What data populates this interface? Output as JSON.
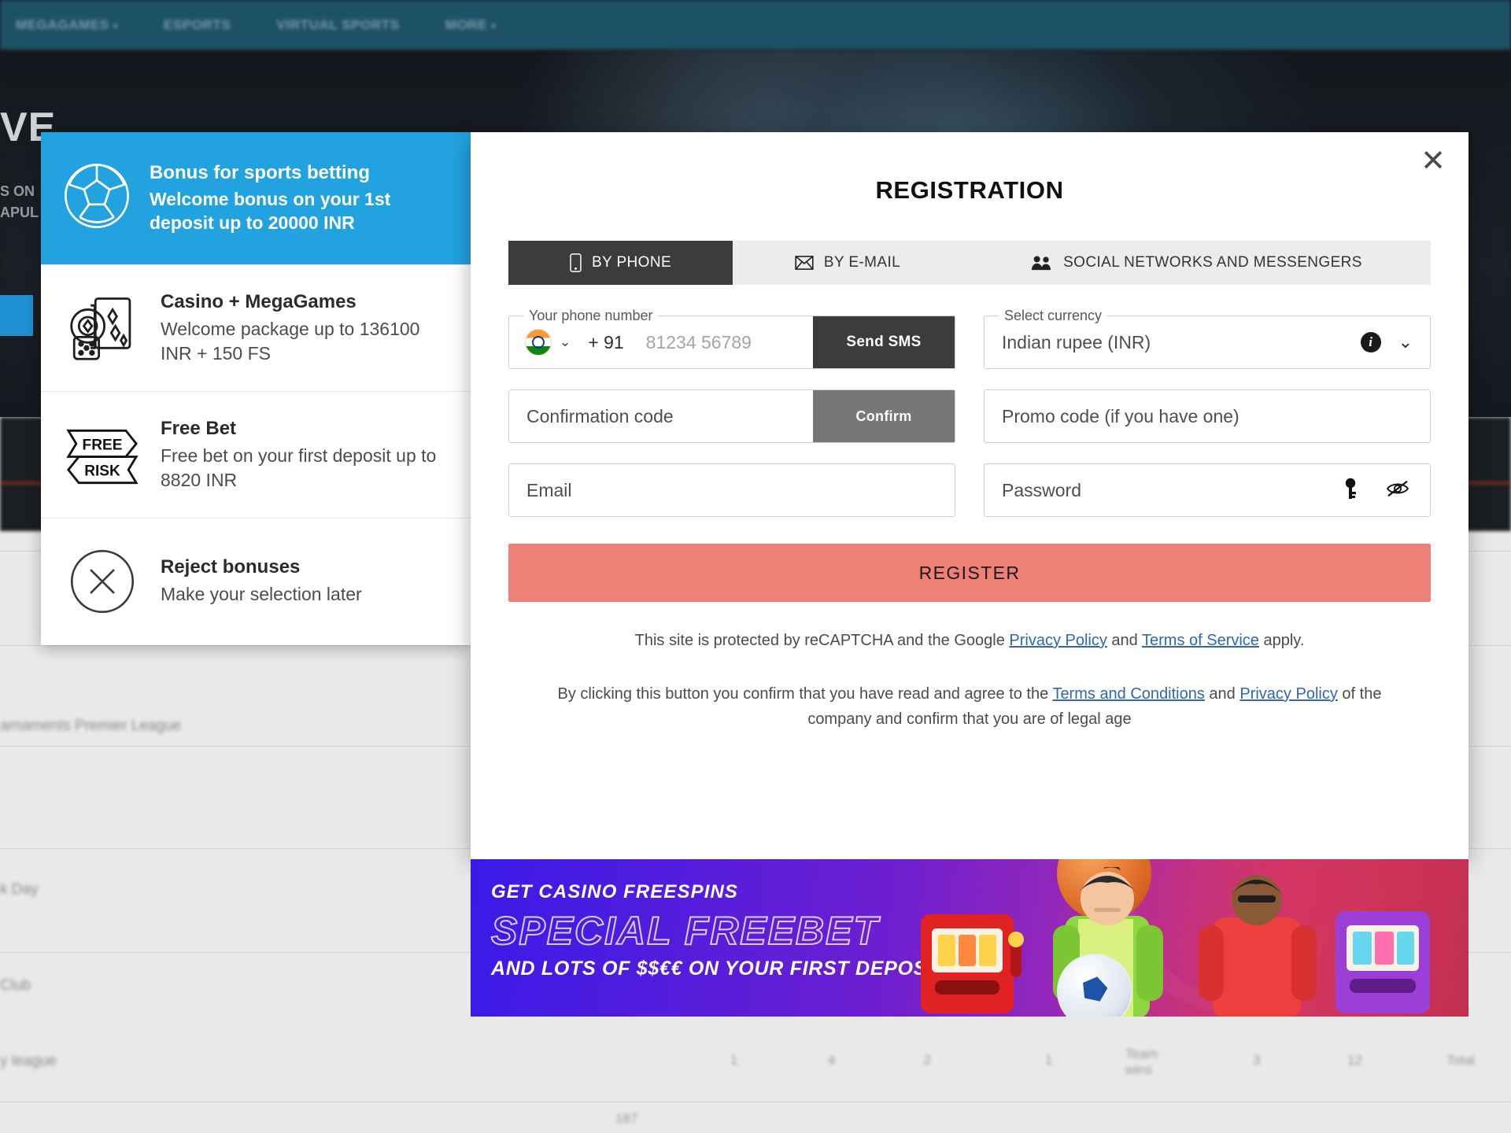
{
  "background": {
    "nav_items": [
      {
        "label": "MEGAGAMES",
        "has_caret": true
      },
      {
        "label": "ESPORTS",
        "has_caret": false
      },
      {
        "label": "VIRTUAL SPORTS",
        "has_caret": false
      },
      {
        "label": "MORE",
        "has_caret": true
      }
    ],
    "hero_title": "VE",
    "hero_sub_line1": "S ON",
    "hero_sub_line2": "APUL",
    "rows": [
      "arnaments Premier League",
      "k Day",
      " Club",
      "y league"
    ],
    "col_numbers": [
      "1",
      "4",
      "2",
      "1",
      "Team\nwins",
      "3",
      "12",
      "Total"
    ],
    "footer_number": "187"
  },
  "bonus_panel": {
    "header": {
      "icon": "soccer-ball-icon",
      "title": "Bonus for sports betting",
      "subtitle": "Welcome bonus on your 1st deposit up to 20000 INR",
      "accent_color": "#22a2df"
    },
    "options": [
      {
        "icon": "casino-chips-cards-icon",
        "title": "Casino + MegaGames",
        "subtitle": "Welcome package up to 136100 INR + 150 FS"
      },
      {
        "icon": "free-risk-bet-icon",
        "title": "Free Bet",
        "subtitle": "Free bet on your first deposit up to 8820 INR"
      },
      {
        "icon": "circle-x-icon",
        "title": "Reject bonuses",
        "subtitle": "Make your selection later"
      }
    ]
  },
  "registration": {
    "title": "REGISTRATION",
    "close_label": "✕",
    "tabs": [
      {
        "id": "phone",
        "label": "BY PHONE",
        "icon": "mobile-phone-icon",
        "active": true
      },
      {
        "id": "email",
        "label": "BY E-MAIL",
        "icon": "envelope-icon",
        "active": false
      },
      {
        "id": "social",
        "label": "SOCIAL NETWORKS AND MESSENGERS",
        "icon": "people-group-icon",
        "active": false
      }
    ],
    "fields": {
      "phone": {
        "legend": "Your phone number",
        "country_flag": "india-flag-icon",
        "dial_code": "+ 91",
        "placeholder": "81234 56789",
        "button_label": "Send SMS"
      },
      "currency": {
        "legend": "Select currency",
        "value": "Indian rupee (INR)",
        "info_icon": "info-icon",
        "chevron_icon": "chevron-down-icon"
      },
      "confirmation": {
        "placeholder": "Confirmation code",
        "button_label": "Confirm"
      },
      "promo": {
        "placeholder": "Promo code (if you have one)"
      },
      "email": {
        "placeholder": "Email"
      },
      "password": {
        "placeholder": "Password",
        "key_icon": "key-icon",
        "toggle_icon": "eye-slash-icon"
      }
    },
    "submit_label": "REGISTER",
    "submit_color": "#ee8078",
    "legal": {
      "recaptcha_prefix": "This site is protected by reCAPTCHA and the Google ",
      "recaptcha_link1": "Privacy Policy",
      "recaptcha_mid": " and ",
      "recaptcha_link2": "Terms of Service",
      "recaptcha_suffix": " apply.",
      "terms_prefix": "By clicking this button you confirm that you have read and agree to the ",
      "terms_link1": "Terms and Conditions",
      "terms_mid": " and ",
      "terms_link2": "Privacy Policy",
      "terms_suffix": " of the company and confirm that you are of legal age"
    }
  },
  "promo_banner": {
    "line1": "GET CASINO FREESPINS",
    "line2": "SPECIAL FREEBET",
    "line3": "AND LOTS OF $$€€ ON YOUR FIRST DEPOSIT"
  }
}
